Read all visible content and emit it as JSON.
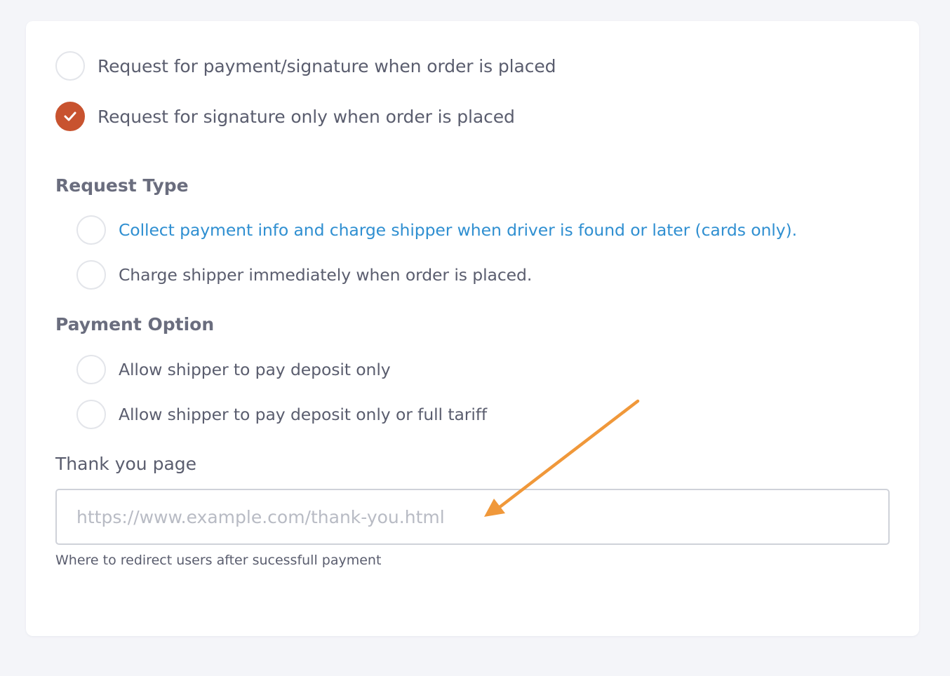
{
  "signature_options": [
    {
      "label": "Request for payment/signature when order is placed",
      "checked": false
    },
    {
      "label": "Request for signature only when order is placed",
      "checked": true
    }
  ],
  "request_type": {
    "heading": "Request Type",
    "options": [
      {
        "label": "Collect payment info and charge shipper when driver is found or later (cards only).",
        "checked": false
      },
      {
        "label": "Charge shipper immediately when order is placed.",
        "checked": false
      }
    ]
  },
  "payment_option": {
    "heading": "Payment Option",
    "options": [
      {
        "label": "Allow shipper to pay deposit only",
        "checked": false
      },
      {
        "label": "Allow shipper to pay deposit only or full tariff",
        "checked": false
      }
    ]
  },
  "thank_you_page": {
    "label": "Thank you page",
    "value": "",
    "placeholder": "https://www.example.com/thank-you.html",
    "help": "Where to redirect users after sucessfull payment"
  },
  "colors": {
    "accent": "#c8532f",
    "link": "#2f8fd1",
    "annotation_arrow": "#f0983a",
    "background": "#f4f5f9"
  },
  "icons": {
    "checked_radio": "check-icon",
    "annotation": "arrow-annotation-icon"
  }
}
